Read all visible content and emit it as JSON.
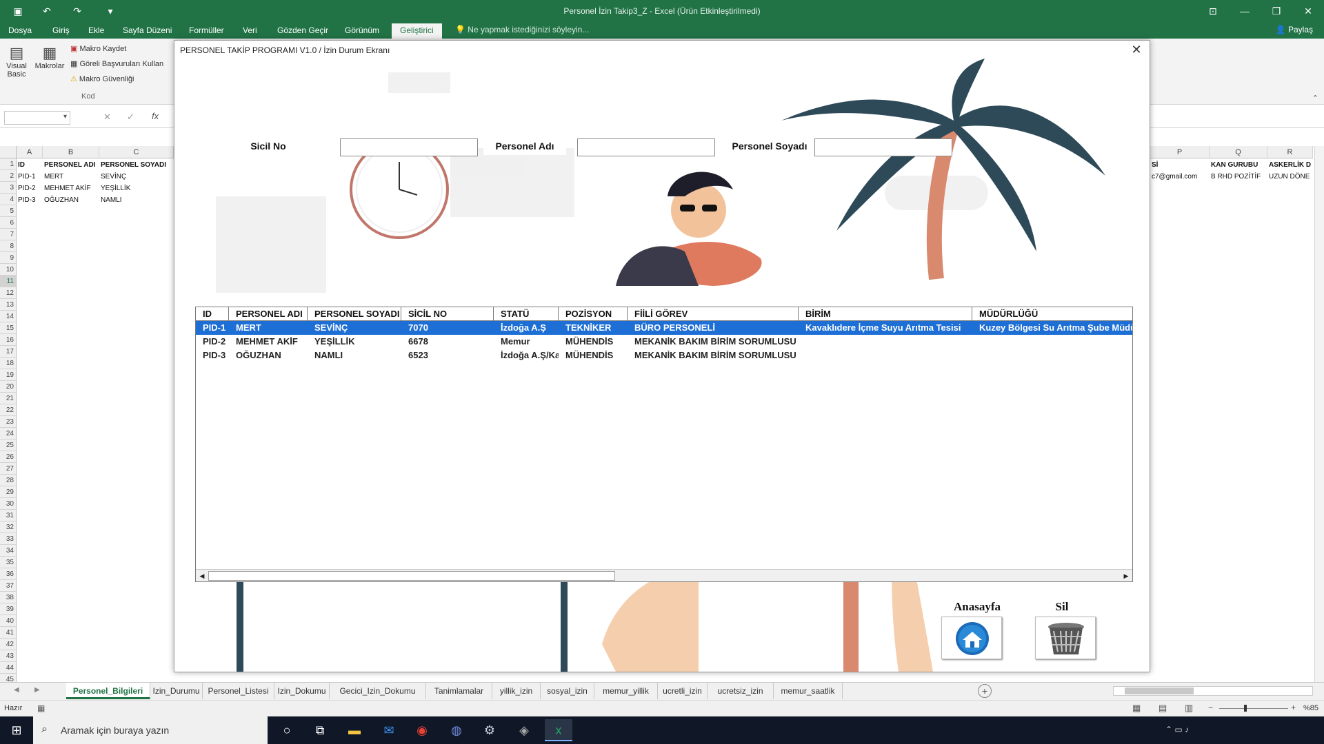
{
  "window": {
    "title": "Personel İzin Takip3_Z - Excel (Ürün Etkinleştirilmedi)"
  },
  "menu": {
    "items": [
      "Dosya",
      "Giriş",
      "Ekle",
      "Sayfa Düzeni",
      "Formüller",
      "Veri",
      "Gözden Geçir",
      "Görünüm",
      "Geliştirici"
    ],
    "tell_me": "Ne yapmak istediğinizi söyleyin...",
    "share": "Paylaş"
  },
  "ribbon": {
    "visual_basic": "Visual Basic",
    "macros": "Makrolar",
    "record_macro": "Makro Kaydet",
    "relative_refs": "Göreli Başvuruları Kullan",
    "macro_security": "Makro Güvenliği",
    "group_code": "Kod"
  },
  "formula": {
    "fx": "fx",
    "cancel": "✕",
    "confirm": "✓"
  },
  "sheet": {
    "columns_left": [
      "A",
      "B",
      "C"
    ],
    "columns_right": [
      "P",
      "Q",
      "R"
    ],
    "headers_left": [
      "ID",
      "PERSONEL ADI",
      "PERSONEL SOYADI"
    ],
    "headers_right": [
      "Sİ",
      "KAN GURUBU",
      "ASKERLİK D"
    ],
    "rows_left": [
      [
        "PID-1",
        "MERT",
        "SEVİNÇ"
      ],
      [
        "PID-2",
        "MEHMET AKİF",
        "YEŞİLLİK"
      ],
      [
        "PID-3",
        "OĞUZHAN",
        "NAMLI"
      ]
    ],
    "rows_right": [
      [
        "c7@gmail.com",
        "B RHD POZİTİF",
        "UZUN DÖNE"
      ]
    ],
    "row_numbers": [
      "1",
      "2",
      "3",
      "4",
      "5",
      "6",
      "7",
      "8",
      "9",
      "10",
      "11",
      "12",
      "13",
      "14",
      "15",
      "16",
      "17",
      "18",
      "19",
      "20",
      "21",
      "22",
      "23",
      "24",
      "25",
      "26",
      "27",
      "28",
      "29",
      "30",
      "31",
      "32",
      "33",
      "34",
      "35",
      "36",
      "37",
      "38",
      "39",
      "40",
      "41",
      "42",
      "43",
      "44",
      "45"
    ]
  },
  "dialog": {
    "title": "PERSONEL TAKİP PROGRAMI V1.0 / İzin Durum Ekranı",
    "labels": {
      "sicil": "Sicil No",
      "ad": "Personel Adı",
      "soyad": "Personel Soyadı"
    },
    "inputs": {
      "sicil": "",
      "ad": "",
      "soyad": ""
    },
    "list": {
      "columns": [
        "ID",
        "PERSONEL ADI",
        "PERSONEL SOYADI",
        "SİCİL NO",
        "STATÜ",
        "POZİSYON",
        "FİİLİ GÖREV",
        "BİRİM",
        "MÜDÜRLÜĞÜ"
      ],
      "rows": [
        [
          "PID-1",
          "MERT",
          "SEVİNÇ",
          "7070",
          "İzdoğa A.Ş",
          "TEKNİKER",
          "BÜRO PERSONELİ",
          "Kavaklıdere İçme Suyu Arıtma Tesisi",
          "Kuzey Bölgesi Su Arıtma Şube Müdü"
        ],
        [
          "PID-2",
          "MEHMET AKİF",
          "YEŞİLLİK",
          "6678",
          "Memur",
          "MÜHENDİS",
          "MEKANİK BAKIM BİRİM SORUMLUSU",
          "",
          ""
        ],
        [
          "PID-3",
          "OĞUZHAN",
          "NAMLI",
          "6523",
          "İzdoğa A.Ş/Ka",
          "MÜHENDİS",
          "MEKANİK BAKIM BİRİM SORUMLUSU",
          "",
          ""
        ]
      ],
      "selected_row": 0
    },
    "buttons": {
      "home": "Anasayfa",
      "delete": "Sil"
    }
  },
  "sheet_tabs": [
    "Personel_Bilgileri",
    "Izin_Durumu",
    "Personel_Listesi",
    "Izin_Dokumu",
    "Gecici_Izin_Dokumu",
    "Tanimlamalar",
    "yillik_izin",
    "sosyal_izin",
    "memur_yillik",
    "ucretli_izin",
    "ucretsiz_izin",
    "memur_saatlik"
  ],
  "status": {
    "ready": "Hazır",
    "zoom": "%85"
  },
  "taskbar": {
    "search_placeholder": "Aramak için buraya yazın"
  },
  "colors": {
    "excel_green": "#217346",
    "selection_blue": "#1d6fd6"
  }
}
